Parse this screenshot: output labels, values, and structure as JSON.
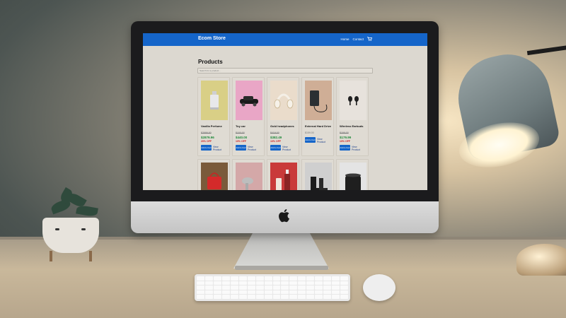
{
  "store": {
    "brand": "Ecom Store",
    "nav": {
      "home": "Home",
      "contact": "Contact"
    },
    "accent_color": "#1565c9"
  },
  "main": {
    "title": "Products",
    "search_placeholder": "Search for a product..."
  },
  "products": [
    {
      "name": "Vanilla Perfume",
      "old_price": "$2999.00",
      "new_price": "$2879.96",
      "discount": "20% OFF",
      "add_label": "Add to Cart",
      "view_label": "View Product",
      "image": "perfume-bottle"
    },
    {
      "name": "Toy car",
      "old_price": "$100.00",
      "new_price": "$440.00",
      "discount": "10% OFF",
      "add_label": "Add to Cart",
      "view_label": "View Product",
      "image": "toy-car"
    },
    {
      "name": "Gold headphones",
      "old_price": "$419.00",
      "new_price": "$382.49",
      "discount": "10% OFF",
      "add_label": "Add to Cart",
      "view_label": "View Product",
      "image": "headphones"
    },
    {
      "name": "External Hard Drive",
      "old_price": "$159.00",
      "new_price": "",
      "discount": "",
      "add_label": "Add to Cart",
      "view_label": "View Product",
      "image": "hard-drive"
    },
    {
      "name": "Wireless Earbuds",
      "old_price": "$199.00",
      "new_price": "$179.99",
      "discount": "10% OFF",
      "add_label": "Add to Cart",
      "view_label": "View Product",
      "image": "earbuds"
    }
  ],
  "products_row2": [
    {
      "image": "red-handbag"
    },
    {
      "image": "hair-dryer"
    },
    {
      "image": "serum-bottles"
    },
    {
      "image": "black-boots"
    },
    {
      "image": "smart-speaker"
    }
  ]
}
